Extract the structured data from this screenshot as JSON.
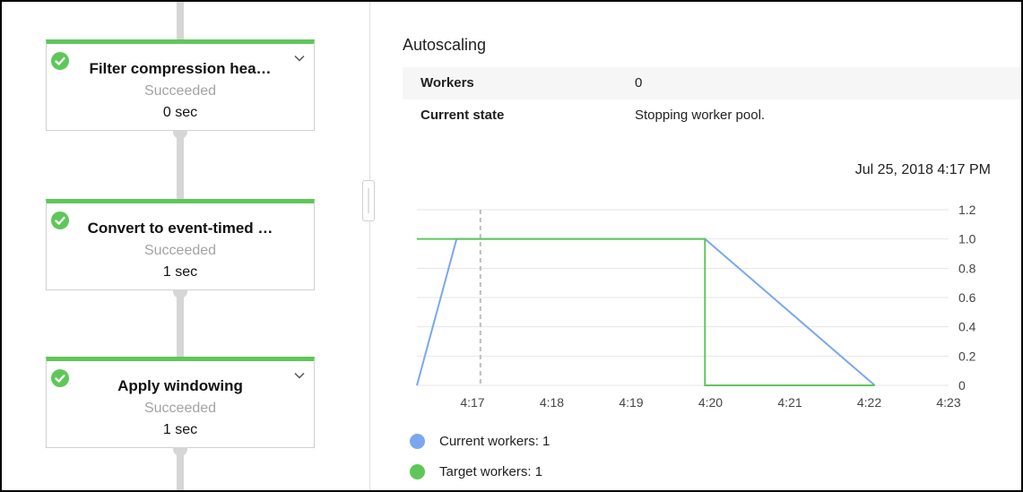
{
  "pipeline": {
    "steps": [
      {
        "title": "Filter compression hea…",
        "status": "Succeeded",
        "duration": "0 sec",
        "has_dropdown": true
      },
      {
        "title": "Convert to event-timed …",
        "status": "Succeeded",
        "duration": "1 sec",
        "has_dropdown": false
      },
      {
        "title": "Apply windowing",
        "status": "Succeeded",
        "duration": "1 sec",
        "has_dropdown": true
      }
    ]
  },
  "autoscaling": {
    "heading": "Autoscaling",
    "rows": [
      {
        "key": "Workers",
        "value": "0"
      },
      {
        "key": "Current state",
        "value": "Stopping worker pool."
      }
    ],
    "timestamp": "Jul 25, 2018 4:17 PM"
  },
  "legend": {
    "current": "Current workers: 1",
    "target": "Target workers: 1"
  },
  "colors": {
    "success": "#5fc75a",
    "current_series": "#7aa7f0",
    "target_series": "#5fc75a"
  },
  "chart_data": {
    "type": "line",
    "x_tick_labels": [
      "4:17",
      "4:18",
      "4:19",
      "4:20",
      "4:21",
      "4:22",
      "4:23"
    ],
    "y_tick_labels": [
      "1.2",
      "1.0",
      "0.8",
      "0.6",
      "0.4",
      "0.2",
      "0"
    ],
    "xlim": [
      "4:16.3",
      "4:23"
    ],
    "ylim": [
      0,
      1.2
    ],
    "marker_x": "4:17.1",
    "grid": true,
    "series": [
      {
        "name": "Current workers",
        "x": [
          "4:16.3",
          "4:16.8",
          "4:19.93",
          "4:22.07"
        ],
        "y": [
          0,
          1,
          1,
          0
        ]
      },
      {
        "name": "Target workers",
        "x": [
          "4:16.3",
          "4:16.8",
          "4:19.93",
          "4:19.93",
          "4:22.07"
        ],
        "y": [
          1,
          1,
          1,
          0,
          0
        ]
      }
    ]
  }
}
